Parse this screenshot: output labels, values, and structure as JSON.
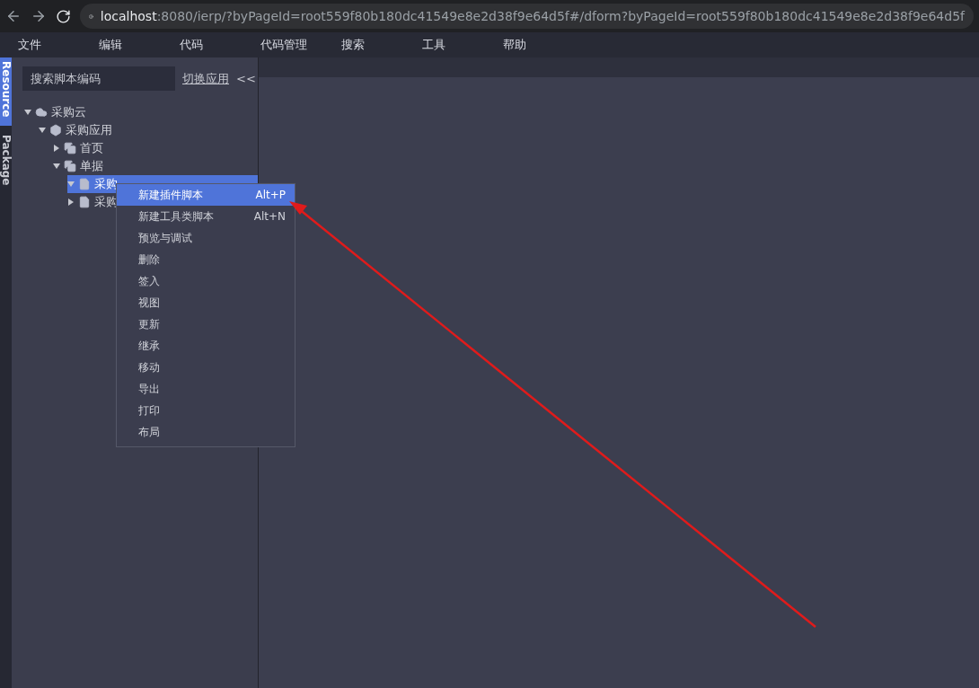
{
  "browser": {
    "url_host": "localhost",
    "url_rest": ":8080/ierp/?byPageId=root559f80b180dc41549e8e2d38f9e64d5f#/dform?byPageId=root559f80b180dc41549e8e2d38f9e64d5f"
  },
  "menu_bar": [
    "文件",
    "编辑",
    "代码",
    "代码管理",
    "搜索",
    "工具",
    "帮助"
  ],
  "side_tabs": [
    {
      "label": "Resource",
      "selected": true
    },
    {
      "label": "Package",
      "selected": false
    }
  ],
  "sidebar": {
    "search": {
      "placeholder": "搜索脚本编码"
    },
    "switch_link": "切换应用",
    "collapse": "<<",
    "tree": [
      {
        "label": "采购云",
        "kind": "cloud",
        "expanded": true,
        "selected": false,
        "children": [
          {
            "label": "采购应用",
            "kind": "app",
            "expanded": true,
            "selected": false,
            "children": [
              {
                "label": "首页",
                "kind": "folder",
                "expanded": false,
                "selected": false
              },
              {
                "label": "单据",
                "kind": "folder",
                "expanded": true,
                "selected": false,
                "children": [
                  {
                    "label": "采购",
                    "kind": "file",
                    "expanded": true,
                    "selected": true
                  },
                  {
                    "label": "采购",
                    "kind": "file",
                    "expanded": false,
                    "selected": false
                  }
                ]
              }
            ]
          }
        ]
      }
    ]
  },
  "context_menu": [
    {
      "label": "新建插件脚本",
      "shortcut": "Alt+P",
      "selected": true
    },
    {
      "label": "新建工具类脚本",
      "shortcut": "Alt+N",
      "selected": false
    },
    {
      "label": "预览与调试",
      "selected": false
    },
    {
      "label": "删除",
      "selected": false
    },
    {
      "label": "签入",
      "selected": false
    },
    {
      "label": "视图",
      "selected": false
    },
    {
      "label": "更新",
      "selected": false
    },
    {
      "label": "继承",
      "selected": false
    },
    {
      "label": "移动",
      "selected": false
    },
    {
      "label": "导出",
      "selected": false
    },
    {
      "label": "打印",
      "selected": false
    },
    {
      "label": "布局",
      "selected": false
    }
  ]
}
